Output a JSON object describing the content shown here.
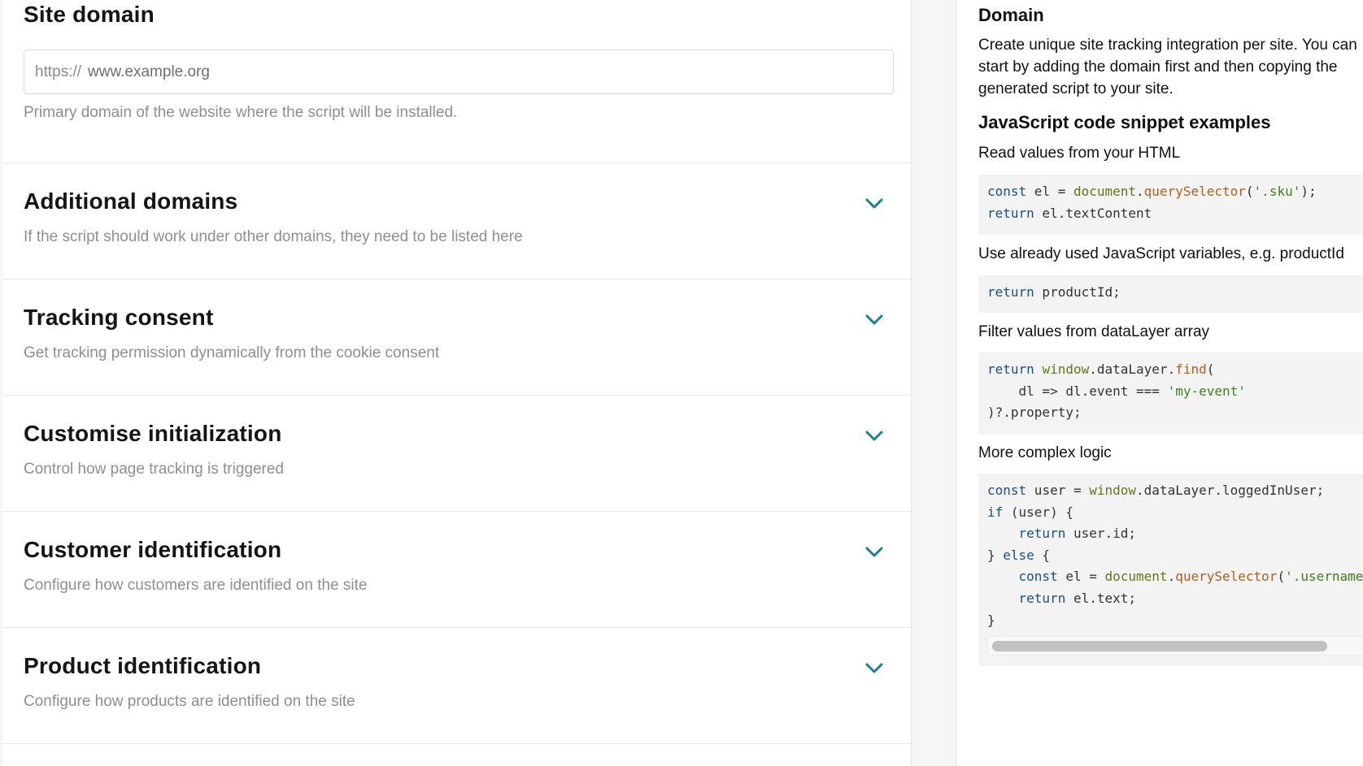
{
  "site_domain": {
    "title": "Site domain",
    "prefix": "https://",
    "placeholder": "www.example.org",
    "help": "Primary domain of the website where the script will be installed."
  },
  "sections": [
    {
      "title": "Additional domains",
      "description": "If the script should work under other domains, they need to be listed here"
    },
    {
      "title": "Tracking consent",
      "description": "Get tracking permission dynamically from the cookie consent"
    },
    {
      "title": "Customise initialization",
      "description": "Control how page tracking is triggered"
    },
    {
      "title": "Customer identification",
      "description": "Configure how customers are identified on the site"
    },
    {
      "title": "Product identification",
      "description": "Configure how products are identified on the site"
    }
  ],
  "help_panel": {
    "heading": "Domain",
    "intro": "Create unique site tracking integration per site. You can start by adding the domain first and then copying the generated script to your site.",
    "examples_heading": "JavaScript code snippet examples",
    "examples": [
      {
        "label": "Read values from your HTML"
      },
      {
        "label": "Use already used JavaScript variables, e.g. productId"
      },
      {
        "label": "Filter values from dataLayer array"
      },
      {
        "label": "More complex logic"
      }
    ]
  },
  "icons": {
    "chevron": "chevron-down-icon"
  },
  "colors": {
    "accent": "#1b7f95",
    "muted_text": "#8e8e93"
  }
}
